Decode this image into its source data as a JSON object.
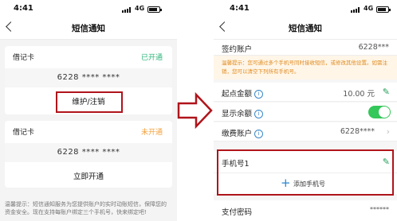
{
  "left": {
    "status": {
      "time": "4:41",
      "network": "4G"
    },
    "nav_title": "短信通知",
    "card1": {
      "title": "借记卡",
      "status": "已开通",
      "status_color": "#2cb57a",
      "number": "6228 **** ****",
      "action": "维护/注销"
    },
    "card2": {
      "title": "借记卡",
      "status": "未开通",
      "status_color": "#f3a03a",
      "number": "6228 **** ****",
      "action": "立即开通"
    },
    "tip_line1": "温馨提示：短信通知服务为您提供账户的实时动账短信，保障您的",
    "tip_line2": "资金安全。现在支持每账户绑定三个手机号，快来绑定吧!"
  },
  "right": {
    "status": {
      "time": "4:41",
      "network": "4G"
    },
    "nav_title": "短信通知",
    "account": {
      "label": "签约账户",
      "value": "6228***"
    },
    "warning": "温馨提示：您可通过多个手机号同时接收短信，或修改其他设置。如需注销，您可以清空下列所有手机号。",
    "min_amount": {
      "label": "起点金额",
      "value": "10.00 元"
    },
    "show_balance": {
      "label": "显示余额",
      "on": true
    },
    "fee_account": {
      "label": "缴费账户",
      "value": "6228****"
    },
    "phone": {
      "label": "手机号1",
      "add": "添加手机号"
    },
    "password": {
      "label": "支付密码",
      "value": "******"
    }
  },
  "colors": {
    "highlight": "#b0141b",
    "accent_green": "#1f9d55",
    "toggle_on": "#34c759"
  },
  "icons": [
    "back-chevron-icon",
    "signal-icon",
    "battery-icon",
    "info-icon",
    "pencil-icon",
    "chevron-right-icon",
    "plus-icon",
    "right-arrow-icon"
  ]
}
